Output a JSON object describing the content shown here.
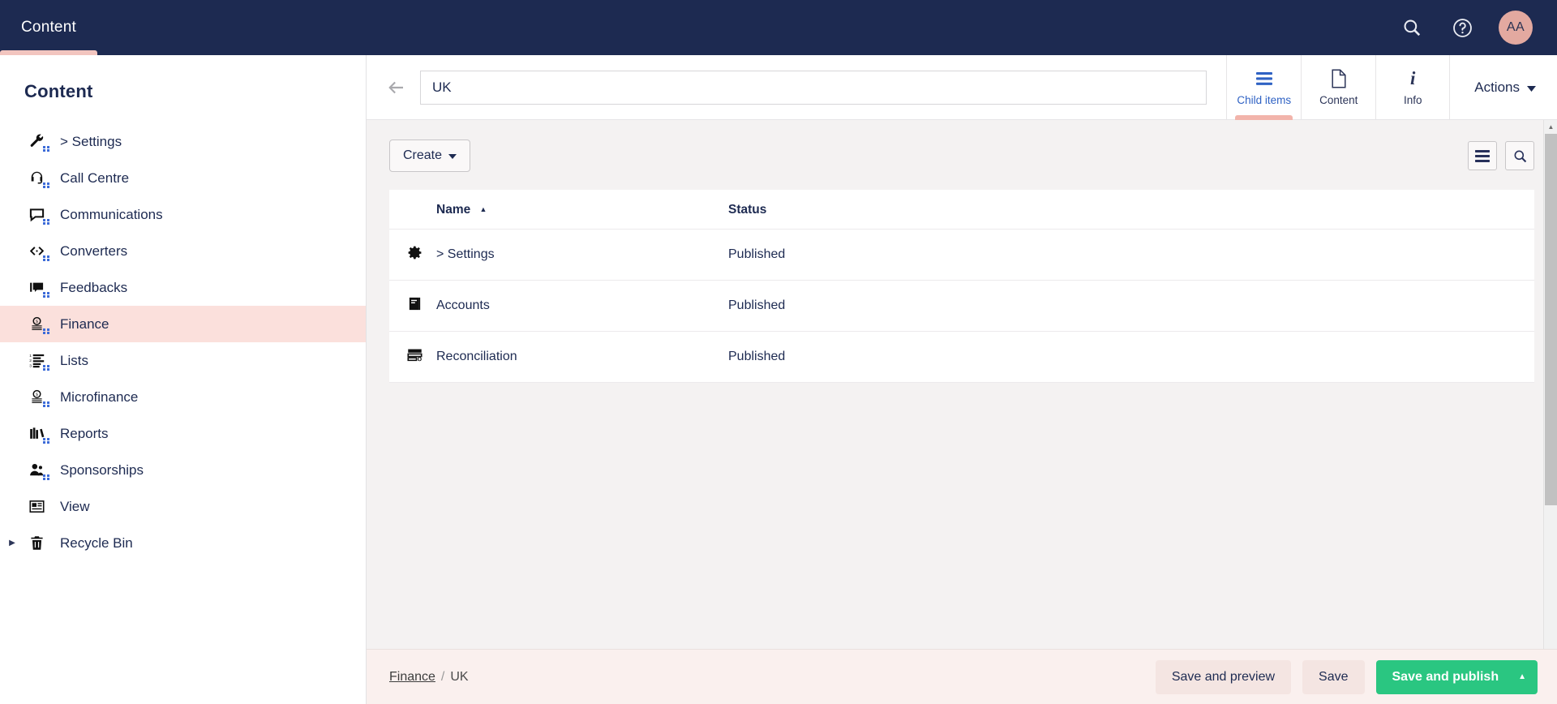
{
  "topbar": {
    "tab_label": "Content",
    "icons": [
      {
        "name": "search-icon",
        "glyph": "search"
      },
      {
        "name": "help-icon",
        "glyph": "question"
      }
    ],
    "avatar_initials": "AA",
    "accent_underline": "#f2c5bf",
    "background": "#1d2a51"
  },
  "sidebar": {
    "title": "Content",
    "items": [
      {
        "label": "> Settings",
        "icon": "wrench-icon",
        "active": false,
        "expandable": false
      },
      {
        "label": "Call Centre",
        "icon": "headset-icon",
        "active": false,
        "expandable": false
      },
      {
        "label": "Communications",
        "icon": "speech-bubble-icon",
        "active": false,
        "expandable": false
      },
      {
        "label": "Converters",
        "icon": "code-arrows-icon",
        "active": false,
        "expandable": false
      },
      {
        "label": "Feedbacks",
        "icon": "feedback-icon",
        "active": false,
        "expandable": false
      },
      {
        "label": "Finance",
        "icon": "coins-icon",
        "active": true,
        "expandable": false
      },
      {
        "label": "Lists",
        "icon": "numbered-list-icon",
        "active": false,
        "expandable": false
      },
      {
        "label": "Microfinance",
        "icon": "coins-icon",
        "active": false,
        "expandable": false
      },
      {
        "label": "Reports",
        "icon": "books-icon",
        "active": false,
        "expandable": false
      },
      {
        "label": "Sponsorships",
        "icon": "people-icon",
        "active": false,
        "expandable": false
      },
      {
        "label": "View",
        "icon": "article-icon",
        "active": false,
        "expandable": false
      },
      {
        "label": "Recycle Bin",
        "icon": "trash-icon",
        "active": false,
        "expandable": true
      }
    ],
    "active_highlight": "#fbe0dc"
  },
  "header": {
    "back_icon": "back-arrow-icon",
    "title_value": "UK",
    "title_placeholder": "Enter a name...",
    "tabs": [
      {
        "label": "Child items",
        "icon": "list-lines-icon",
        "active": true
      },
      {
        "label": "Content",
        "icon": "document-icon",
        "active": false
      },
      {
        "label": "Info",
        "icon": "info-icon",
        "active": false
      }
    ],
    "actions_label": "Actions",
    "active_tab_underline": "#f2b4ab",
    "active_tab_color": "#2f62c4"
  },
  "toolbar": {
    "create_label": "Create",
    "view_toggle_icon": "list-view-icon",
    "search_icon": "search-icon"
  },
  "table": {
    "columns": [
      {
        "key": "icon",
        "label": ""
      },
      {
        "key": "name",
        "label": "Name",
        "sort": "asc",
        "sort_glyph": "▲"
      },
      {
        "key": "status",
        "label": "Status"
      }
    ],
    "rows": [
      {
        "icon": "gear-icon",
        "name": "> Settings",
        "status": "Published"
      },
      {
        "icon": "book-icon",
        "name": "Accounts",
        "status": "Published"
      },
      {
        "icon": "reconciliation-icon",
        "name": "Reconciliation",
        "status": "Published"
      }
    ]
  },
  "scrollbar": {
    "up_glyph": "▲",
    "down_glyph": "▼",
    "thumb_position_percent": 0
  },
  "footer": {
    "breadcrumb": [
      {
        "label": "Finance",
        "link": true
      },
      {
        "label": "UK",
        "link": false
      }
    ],
    "breadcrumb_separator": "/",
    "buttons": [
      {
        "label": "Save and preview",
        "style": "light"
      },
      {
        "label": "Save",
        "style": "light"
      },
      {
        "label": "Save and publish",
        "style": "primary",
        "caret": "▲"
      }
    ],
    "primary_color": "#2ac681",
    "background": "#faf0ee"
  }
}
